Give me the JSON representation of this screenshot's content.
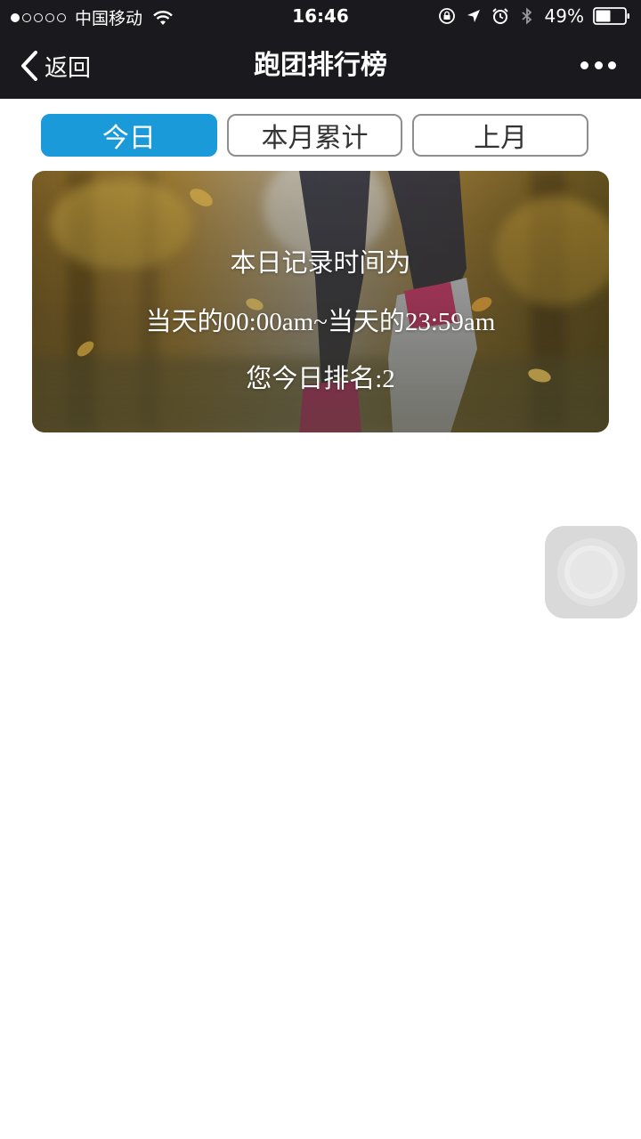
{
  "status_bar": {
    "carrier": "中国移动",
    "time": "16:46",
    "battery": "49%",
    "battery_level": 0.49,
    "icons": [
      "signal-dots-icon",
      "wifi-icon",
      "rotation-lock-icon",
      "location-arrow-icon",
      "alarm-icon",
      "bluetooth-icon",
      "battery-icon"
    ]
  },
  "nav": {
    "back_label": "返回",
    "title": "跑团排行榜",
    "more_icon": "more-dots-icon"
  },
  "tabs": [
    {
      "label": "今日",
      "active": true
    },
    {
      "label": "本月累计",
      "active": false
    },
    {
      "label": "上月",
      "active": false
    }
  ],
  "banner": {
    "line1": "本日记录时间为",
    "line2": "当天的00:00am~当天的23:59am",
    "line3": "您今日排名:2"
  },
  "colors": {
    "accent": "#1a9ad9",
    "nav_bg": "#1a1a1e"
  }
}
